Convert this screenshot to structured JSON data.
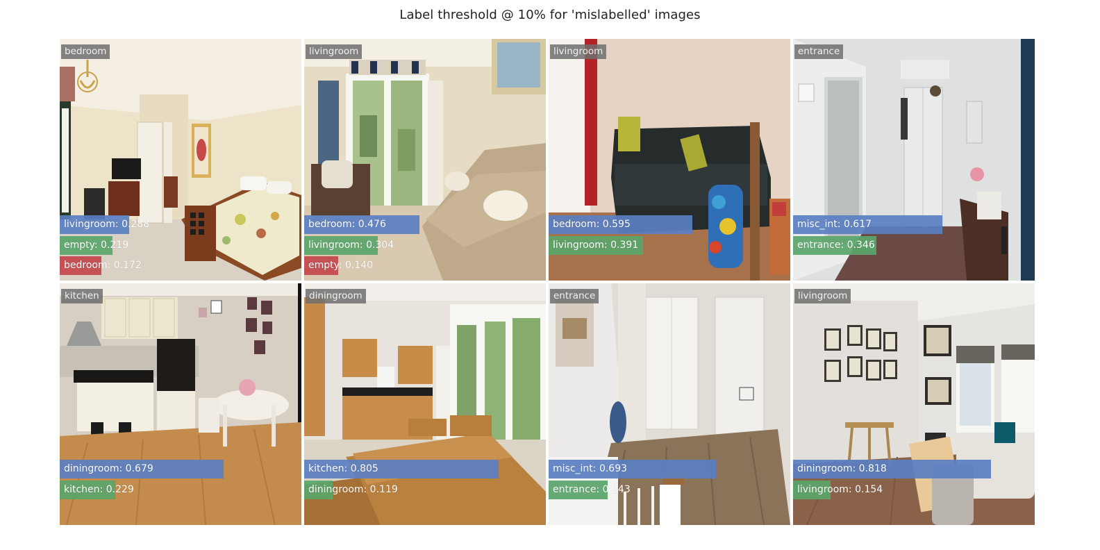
{
  "title": "Label threshold @ 10% for 'mislabelled' images",
  "colors": {
    "rank1": "#5a7fc2",
    "rank2": "#5aa56a",
    "rank3": "#c4464c",
    "label_bg": "#6e6e6e"
  },
  "tiles": [
    {
      "label": "bedroom",
      "scene": "bedroom-photo",
      "predictions": [
        {
          "text": "livingroom: 0.288",
          "score": 0.288
        },
        {
          "text": "empty: 0.219",
          "score": 0.219
        },
        {
          "text": "bedroom: 0.172",
          "score": 0.172
        }
      ]
    },
    {
      "label": "livingroom",
      "scene": "livingroom-window-photo",
      "predictions": [
        {
          "text": "bedroom: 0.476",
          "score": 0.476
        },
        {
          "text": "livingroom: 0.304",
          "score": 0.304
        },
        {
          "text": "empty: 0.140",
          "score": 0.14
        }
      ]
    },
    {
      "label": "livingroom",
      "scene": "livingroom-sofa-photo",
      "predictions": [
        {
          "text": "bedroom: 0.595",
          "score": 0.595
        },
        {
          "text": "livingroom: 0.391",
          "score": 0.391
        }
      ]
    },
    {
      "label": "entrance",
      "scene": "hallway-photo",
      "predictions": [
        {
          "text": "misc_int: 0.617",
          "score": 0.617
        },
        {
          "text": "entrance: 0.346",
          "score": 0.346
        }
      ]
    },
    {
      "label": "kitchen",
      "scene": "kitchen-dining-photo",
      "predictions": [
        {
          "text": "diningroom: 0.679",
          "score": 0.679
        },
        {
          "text": "kitchen: 0.229",
          "score": 0.229
        }
      ]
    },
    {
      "label": "diningroom",
      "scene": "kitchen-table-photo",
      "predictions": [
        {
          "text": "kitchen: 0.805",
          "score": 0.805
        },
        {
          "text": "diningroom: 0.119",
          "score": 0.119
        }
      ]
    },
    {
      "label": "entrance",
      "scene": "entrance-stairs-photo",
      "predictions": [
        {
          "text": "misc_int: 0.693",
          "score": 0.693
        },
        {
          "text": "entrance: 0.243",
          "score": 0.243
        }
      ]
    },
    {
      "label": "livingroom",
      "scene": "livingroom-dining-photo",
      "predictions": [
        {
          "text": "diningroom: 0.818",
          "score": 0.818
        },
        {
          "text": "livingroom: 0.154",
          "score": 0.154
        }
      ]
    }
  ]
}
